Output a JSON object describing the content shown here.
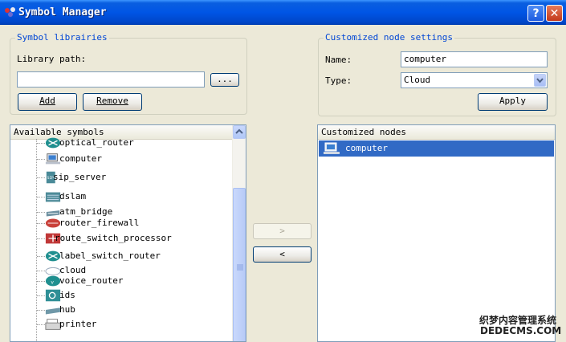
{
  "window": {
    "title": "Symbol Manager",
    "help_label": "?",
    "close_label": "✕"
  },
  "libraries": {
    "legend": "Symbol librairies",
    "path_label": "Library path:",
    "path_value": "",
    "browse_label": "...",
    "add_label": "Add",
    "remove_label": "Remove"
  },
  "node_settings": {
    "legend": "Customized node settings",
    "name_label": "Name:",
    "name_value": "computer",
    "type_label": "Type:",
    "type_value": "Cloud",
    "apply_label": "Apply"
  },
  "available": {
    "header": "Available symbols",
    "items": [
      {
        "label": "optical_router",
        "icon": "optical-router-icon"
      },
      {
        "label": "computer",
        "icon": "computer-icon"
      },
      {
        "label": "sip_server",
        "icon": "sip-server-icon"
      },
      {
        "label": "dslam",
        "icon": "dslam-icon"
      },
      {
        "label": "atm_bridge",
        "icon": "atm-bridge-icon"
      },
      {
        "label": "router_firewall",
        "icon": "router-firewall-icon"
      },
      {
        "label": "route_switch_processor",
        "icon": "route-switch-processor-icon"
      },
      {
        "label": "label_switch_router",
        "icon": "label-switch-router-icon"
      },
      {
        "label": "cloud",
        "icon": "cloud-icon"
      },
      {
        "label": "voice_router",
        "icon": "voice-router-icon"
      },
      {
        "label": "ids",
        "icon": "ids-icon"
      },
      {
        "label": "hub",
        "icon": "hub-icon"
      },
      {
        "label": "printer",
        "icon": "printer-icon"
      }
    ]
  },
  "transfer": {
    "add_arrow": ">",
    "remove_arrow": "<"
  },
  "customized": {
    "header": "Customized nodes",
    "items": [
      {
        "label": "computer",
        "icon": "computer-icon"
      }
    ]
  },
  "watermark": {
    "line1": "织梦内容管理系统",
    "line2": "DEDECMS.COM"
  }
}
